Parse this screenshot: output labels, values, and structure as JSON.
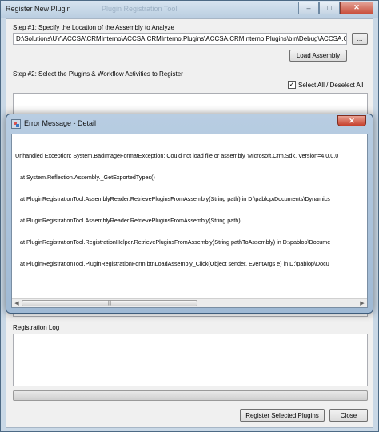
{
  "window": {
    "title": "Register New Plugin",
    "ghost_title": "Plugin Registration Tool",
    "minimize_glyph": "–",
    "maximize_glyph": "□",
    "close_glyph": "✕"
  },
  "step1": {
    "label": "Step #1: Specify the Location of the Assembly to Analyze",
    "path_value": "D:\\Solutions\\UY\\ACCSA\\CRMInterno\\ACCSA.CRMInterno.Plugins\\ACCSA.CRMInterno.Plugins\\bin\\Debug\\ACCSA.CRMInterno.Plugins.dll",
    "browse_label": "...",
    "load_label": "Load Assembly"
  },
  "step2": {
    "label": "Step #2: Select the Plugins & Workflow Activities to Register",
    "select_all_label": "Select All / Deselect All",
    "select_all_checked": true
  },
  "log": {
    "label": "Registration Log"
  },
  "buttons": {
    "register_label": "Register Selected Plugins",
    "close_label": "Close"
  },
  "dialog": {
    "title": "Error Message - Detail",
    "close_glyph": "✕",
    "lines": [
      "Unhandled Exception: System.BadImageFormatException: Could not load file or assembly 'Microsoft.Crm.Sdk, Version=4.0.0.0",
      "   at System.Reflection.Assembly._GetExportedTypes()",
      "   at PluginRegistrationTool.AssemblyReader.RetrievePluginsFromAssembly(String path) in D:\\pablop\\Documents\\Dynamics",
      "   at PluginRegistrationTool.AssemblyReader.RetrievePluginsFromAssembly(String path)",
      "   at PluginRegistrationTool.RegistrationHelper.RetrievePluginsFromAssembly(String pathToAssembly) in D:\\pablop\\Docume",
      "   at PluginRegistrationTool.PluginRegistrationForm.btnLoadAssembly_Click(Object sender, EventArgs e) in D:\\pablop\\Docu"
    ],
    "scroll_left": "◀",
    "scroll_right": "▶",
    "thumb_grip": "|||"
  }
}
